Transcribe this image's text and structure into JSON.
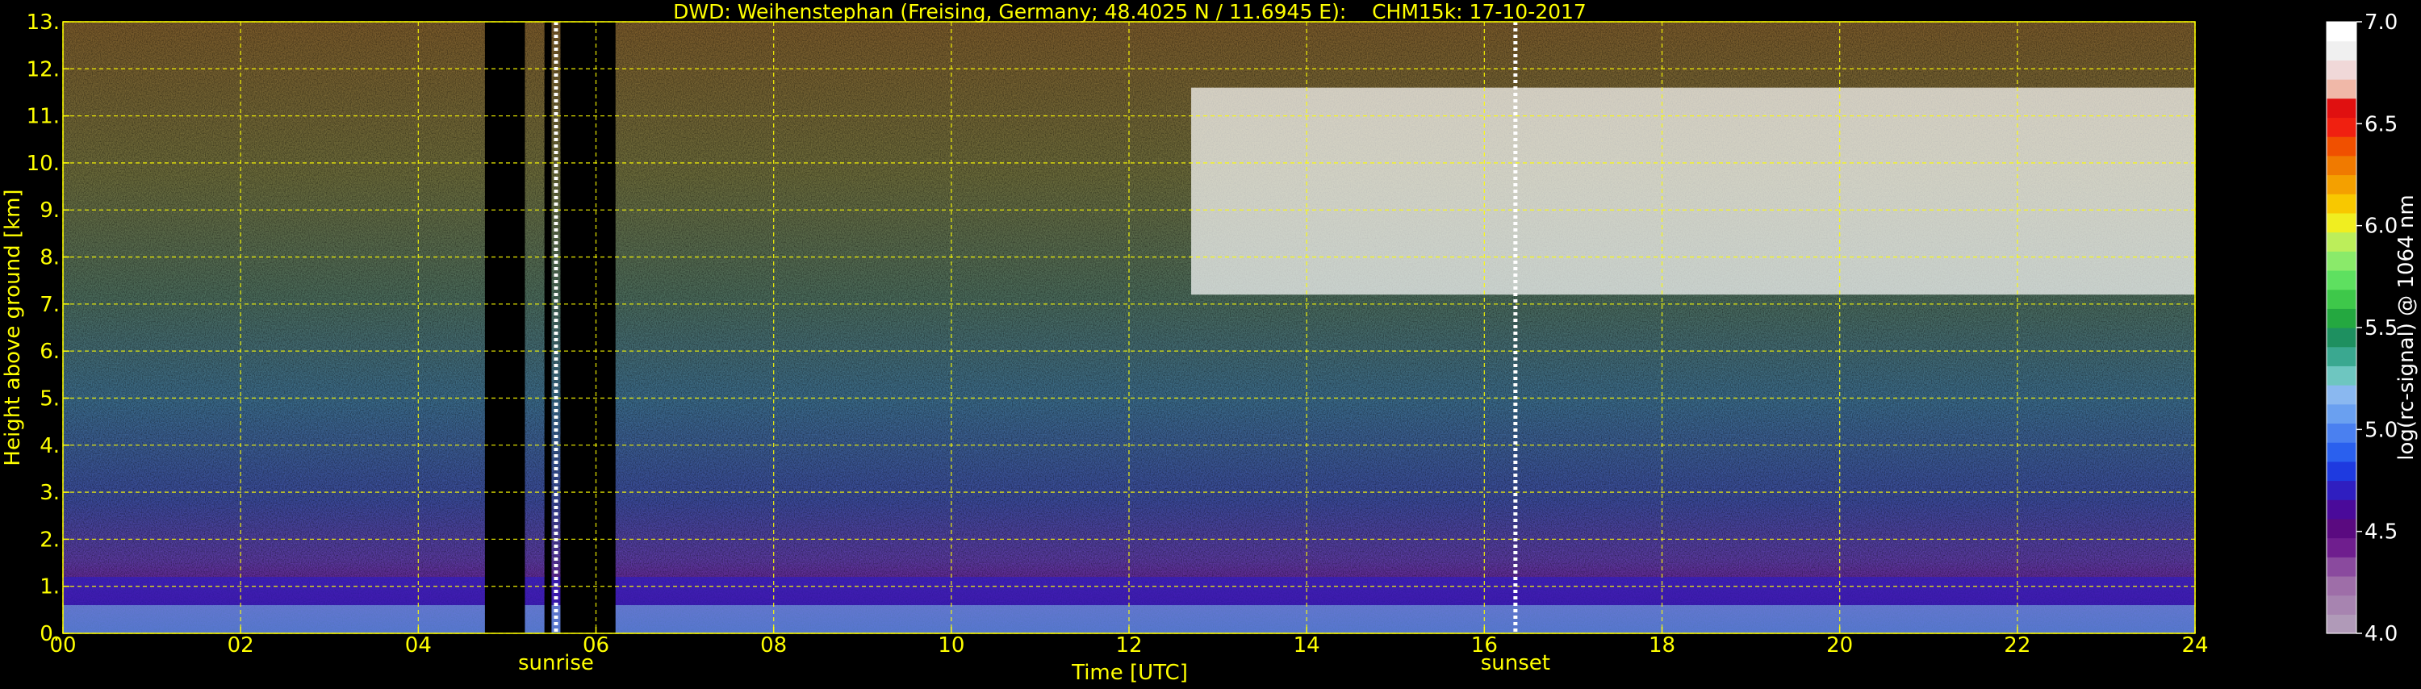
{
  "chart_data": {
    "type": "heatmap",
    "title": "DWD: Weihenstephan (Freising, Germany; 48.4025 N / 11.6945 E):    CHM15k: 17-10-2017",
    "xlabel": "Time [UTC]",
    "ylabel": "Height above ground [km]",
    "xlim": [
      0,
      24
    ],
    "ylim": [
      0,
      13
    ],
    "x_ticks": [
      "00",
      "02",
      "04",
      "06",
      "08",
      "10",
      "12",
      "14",
      "16",
      "18",
      "20",
      "22",
      "24"
    ],
    "y_ticks": [
      "0.",
      "1.",
      "2.",
      "3.",
      "4.",
      "5.",
      "6.",
      "7.",
      "8.",
      "9.",
      "10.",
      "11.",
      "12.",
      "13."
    ],
    "grid": true,
    "grid_color": "#ffff00",
    "text_color": "#ffff00",
    "background": "#000000",
    "markers": [
      {
        "label": "sunrise",
        "time": 5.55
      },
      {
        "label": "sunset",
        "time": 16.35
      }
    ],
    "data_gaps": [
      [
        4.75,
        5.2
      ],
      [
        5.42,
        5.5
      ],
      [
        5.6,
        6.22
      ]
    ],
    "layers": [
      {
        "feature": "boundary layer (strong signal)",
        "start": 0,
        "end": 24,
        "base_km": 0.0,
        "top_km": 0.6,
        "level": 5.1
      },
      {
        "feature": "residual layer",
        "start": 0,
        "end": 24,
        "base_km": 0.6,
        "top_km": 1.2,
        "level": 4.7
      },
      {
        "feature": "cirrus cloud",
        "start": 12.7,
        "end": 24,
        "base_km": 7.2,
        "top_km": 11.6,
        "level": 7.0
      }
    ],
    "colorbar": {
      "label": "log(rc-signal) @ 1064 nm",
      "min": 4.0,
      "max": 7.0,
      "ticks": [
        "4.0",
        "4.5",
        "5.0",
        "5.5",
        "6.0",
        "6.5",
        "7.0"
      ],
      "colors": [
        "#b09ab8",
        "#a784b0",
        "#9e6ea8",
        "#8a4a9e",
        "#6f1e8e",
        "#5a0a80",
        "#4a0a9a",
        "#2f1ec0",
        "#1e3ae0",
        "#2a60ee",
        "#4a80f0",
        "#6aa0f0",
        "#8ab8f0",
        "#6ec6c0",
        "#3aa890",
        "#1e9060",
        "#24a840",
        "#3ec84a",
        "#5ee060",
        "#8aea6a",
        "#bcee5a",
        "#f0ee20",
        "#f8c800",
        "#f4a000",
        "#f07a00",
        "#f05000",
        "#f02010",
        "#e01010",
        "#f0b8a8",
        "#f0d8d8",
        "#f0f0f0",
        "#ffffff"
      ]
    }
  }
}
